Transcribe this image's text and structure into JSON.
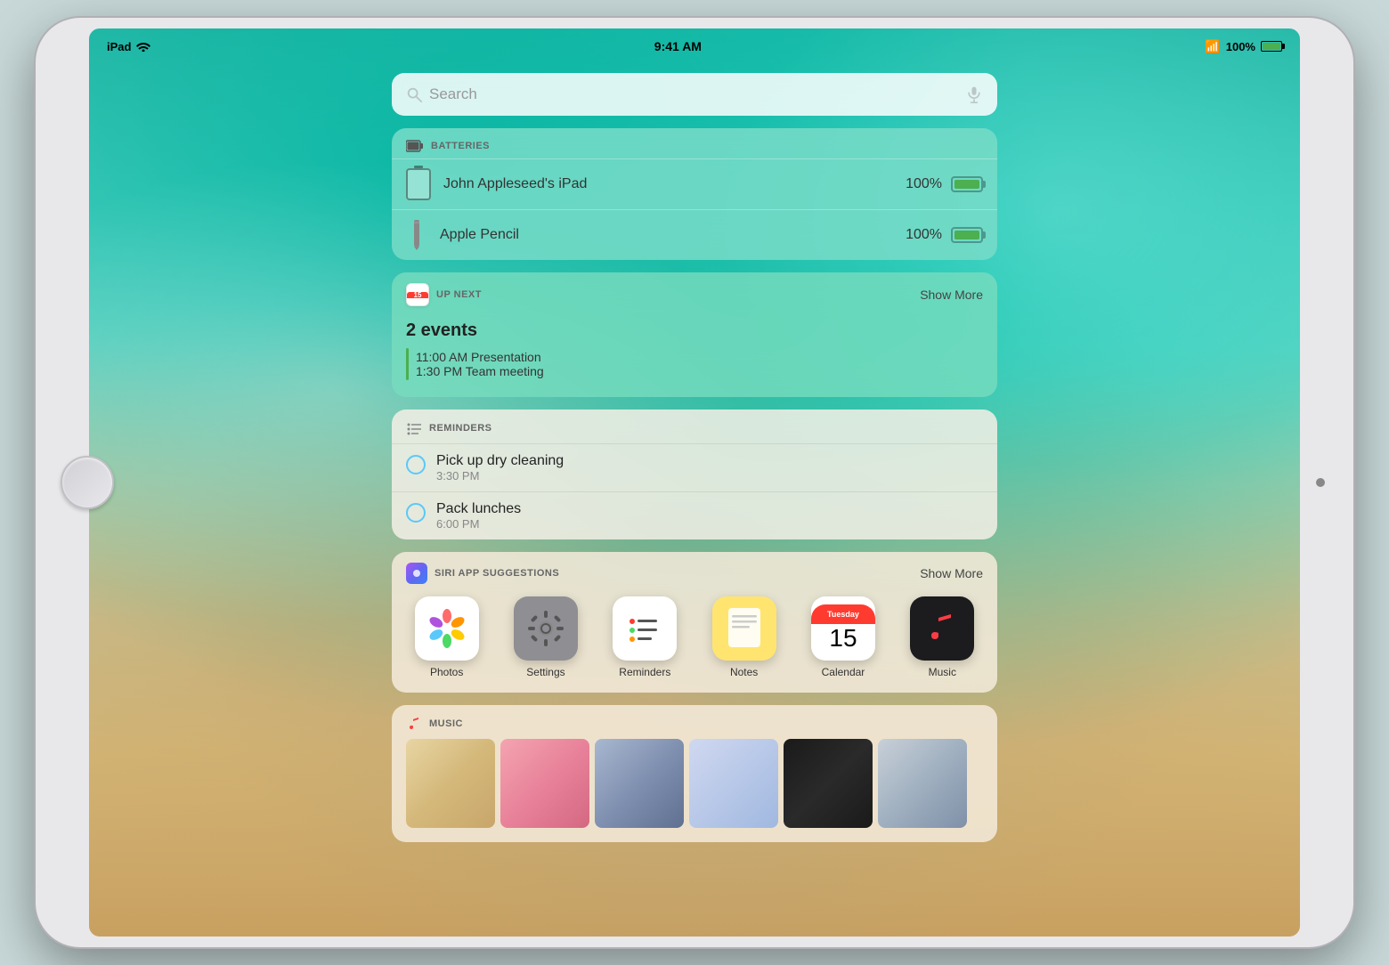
{
  "device": {
    "model": "iPad",
    "status_bar": {
      "carrier": "iPad",
      "wifi": true,
      "time": "9:41 AM",
      "bluetooth": true,
      "battery": "100%"
    }
  },
  "search": {
    "placeholder": "Search"
  },
  "widgets": {
    "batteries": {
      "title": "BATTERIES",
      "items": [
        {
          "name": "John Appleseed's iPad",
          "percentage": "100%",
          "type": "ipad"
        },
        {
          "name": "Apple Pencil",
          "percentage": "100%",
          "type": "pencil"
        }
      ]
    },
    "upnext": {
      "title": "UP NEXT",
      "show_more": "Show More",
      "events_summary": "2 events",
      "events": [
        {
          "time": "11:00 AM",
          "name": "Presentation"
        },
        {
          "time": "1:30 PM",
          "name": "Team meeting"
        }
      ]
    },
    "reminders": {
      "title": "REMINDERS",
      "items": [
        {
          "name": "Pick up dry cleaning",
          "time": "3:30 PM"
        },
        {
          "name": "Pack lunches",
          "time": "6:00 PM"
        }
      ]
    },
    "siri_suggestions": {
      "title": "SIRI APP SUGGESTIONS",
      "show_more": "Show More",
      "apps": [
        {
          "name": "Photos",
          "type": "photos"
        },
        {
          "name": "Settings",
          "type": "settings"
        },
        {
          "name": "Reminders",
          "type": "reminders"
        },
        {
          "name": "Notes",
          "type": "notes"
        },
        {
          "name": "Calendar",
          "type": "calendar",
          "day": "Tuesday",
          "date": "15"
        },
        {
          "name": "Music",
          "type": "music"
        }
      ]
    },
    "music": {
      "title": "MUSIC",
      "albums": [
        {
          "id": 1
        },
        {
          "id": 2
        },
        {
          "id": 3
        },
        {
          "id": 4
        },
        {
          "id": 5
        },
        {
          "id": 6
        }
      ]
    }
  }
}
